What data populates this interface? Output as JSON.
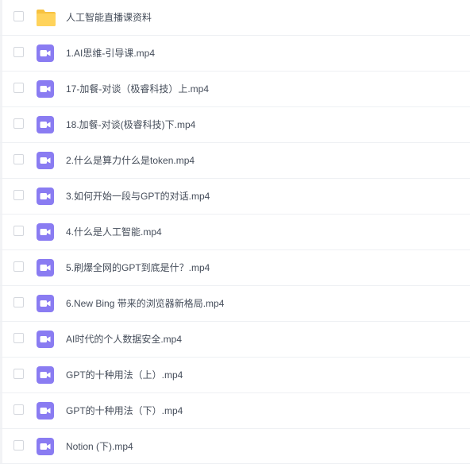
{
  "files": [
    {
      "name": "人工智能直播课资料",
      "icon": "folder-icon"
    },
    {
      "name": "1.AI思维-引导课.mp4",
      "icon": "video-file-icon"
    },
    {
      "name": "17-加餐-对谈（极睿科技）上.mp4",
      "icon": "video-file-icon"
    },
    {
      "name": "18.加餐-对谈(极睿科技)下.mp4",
      "icon": "video-file-icon"
    },
    {
      "name": "2.什么是算力什么是token.mp4",
      "icon": "video-file-icon"
    },
    {
      "name": "3.如何开始一段与GPT的对话.mp4",
      "icon": "video-file-icon"
    },
    {
      "name": "4.什么是人工智能.mp4",
      "icon": "video-file-icon"
    },
    {
      "name": "5.刷爆全网的GPT到底是什？.mp4",
      "icon": "video-file-icon"
    },
    {
      "name": "6.New Bing 带来的浏览器新格局.mp4",
      "icon": "video-file-icon"
    },
    {
      "name": "AI时代的个人数据安全.mp4",
      "icon": "video-file-icon"
    },
    {
      "name": "GPT的十种用法（上）.mp4",
      "icon": "video-file-icon"
    },
    {
      "name": "GPT的十种用法（下）.mp4",
      "icon": "video-file-icon"
    },
    {
      "name": "Notion (下).mp4",
      "icon": "video-file-icon"
    }
  ],
  "colors": {
    "folder": "#ffd35b",
    "folder_tab": "#f7c240",
    "video": "#8a7cf2",
    "text": "#454d5a",
    "divider": "#eef0f3",
    "checkbox_border": "#d4d7dd"
  }
}
